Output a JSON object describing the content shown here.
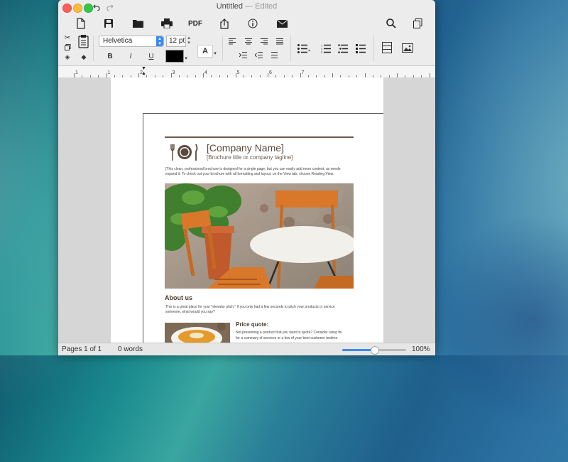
{
  "window": {
    "title": "Untitled",
    "title_suffix": "— Edited"
  },
  "toolbar": {
    "items": [
      "new-document-icon",
      "save-icon",
      "open-folder-icon",
      "print-icon",
      "export-icon",
      "info-icon",
      "mail-icon",
      "search-icon",
      "duplicate-icon"
    ],
    "pdf_label": "PDF"
  },
  "format": {
    "font_family": "Helvetica",
    "font_size": "12 pt",
    "bold_label": "B",
    "italic_label": "I",
    "underline_label": "U",
    "text_color": "#000000",
    "highlight_label": "A"
  },
  "ruler": {
    "numbers": [
      "1",
      "1",
      "2",
      "3",
      "4",
      "5",
      "6",
      "7"
    ]
  },
  "document": {
    "company_name": "[Company Name]",
    "tagline": "[Brochure title or company tagline]",
    "intro_line1": "[This clean, professional brochure is designed for a single page, but you can easily add more content; as neede",
    "intro_line2": "expand it. To check out your brochure with all formatting and layout, on the View tab, choose Reading View.",
    "about_heading": "About us",
    "about_line1": "This is a great place for your \"elevator pitch.\" If you only had a few seconds to pitch your products or service",
    "about_line2": "someone, what would you say?",
    "price_heading": "Price quote:",
    "price_line1": "Not presenting a product that you want to quote? Consider using thi",
    "price_line2": "for a summary of services or a few of your best customer testimo"
  },
  "status": {
    "pages": "Pages 1 of 1",
    "words": "0 words",
    "zoom": "100%",
    "zoom_level": 0.5
  },
  "colors": {
    "accent": "#2f7de1",
    "heading": "#5a4a3c",
    "rule": "#6b5a4a"
  }
}
